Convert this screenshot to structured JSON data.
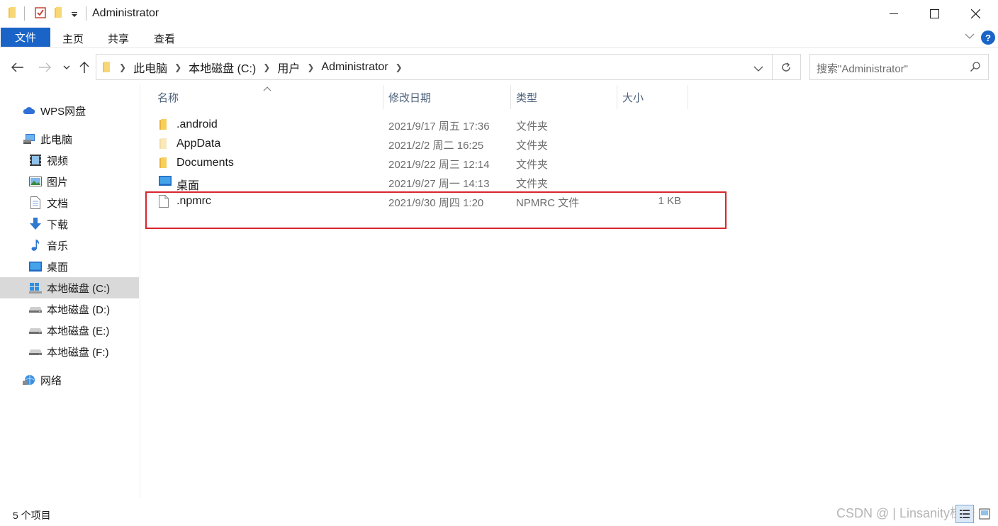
{
  "window": {
    "title": "Administrator"
  },
  "ribbon": {
    "tabs": [
      "文件",
      "主页",
      "共享",
      "查看"
    ],
    "help_label": "?"
  },
  "address": {
    "crumbs": [
      "此电脑",
      "本地磁盘 (C:)",
      "用户",
      "Administrator"
    ]
  },
  "search": {
    "placeholder": "搜索\"Administrator\""
  },
  "sidebar": {
    "items": [
      {
        "label": "WPS网盘",
        "icon": "cloud-icon"
      },
      {
        "label": "此电脑",
        "icon": "computer-icon"
      },
      {
        "label": "视频",
        "icon": "video-icon"
      },
      {
        "label": "图片",
        "icon": "pictures-icon"
      },
      {
        "label": "文档",
        "icon": "documents-icon"
      },
      {
        "label": "下载",
        "icon": "download-icon"
      },
      {
        "label": "音乐",
        "icon": "music-icon"
      },
      {
        "label": "桌面",
        "icon": "desktop-icon"
      },
      {
        "label": "本地磁盘 (C:)",
        "icon": "windows-drive-icon"
      },
      {
        "label": "本地磁盘 (D:)",
        "icon": "drive-icon"
      },
      {
        "label": "本地磁盘 (E:)",
        "icon": "drive-icon"
      },
      {
        "label": "本地磁盘 (F:)",
        "icon": "drive-icon"
      },
      {
        "label": "网络",
        "icon": "network-icon"
      }
    ],
    "selected": "本地磁盘 (C:)"
  },
  "columns": [
    "名称",
    "修改日期",
    "类型",
    "大小"
  ],
  "files": [
    {
      "name": ".android",
      "date": "2021/9/17 周五 17:36",
      "type": "文件夹",
      "size": "",
      "icon": "folder-icon"
    },
    {
      "name": "AppData",
      "date": "2021/2/2 周二 16:25",
      "type": "文件夹",
      "size": "",
      "icon": "folder-hidden-icon"
    },
    {
      "name": "Documents",
      "date": "2021/9/22 周三 12:14",
      "type": "文件夹",
      "size": "",
      "icon": "folder-icon"
    },
    {
      "name": "桌面",
      "date": "2021/9/27 周一 14:13",
      "type": "文件夹",
      "size": "",
      "icon": "desktop-folder-icon"
    },
    {
      "name": ".npmrc",
      "date": "2021/9/30 周四 1:20",
      "type": "NPMRC 文件",
      "size": "1 KB",
      "icon": "file-icon"
    }
  ],
  "status": {
    "item_count": "5 个项目"
  },
  "watermark": "CSDN @ | Linsanity桂皓",
  "colors": {
    "accent": "#1a64c8",
    "selected_bg": "#d9d9d9",
    "highlight_box": "#d9242e",
    "header_text": "#4c607a"
  }
}
